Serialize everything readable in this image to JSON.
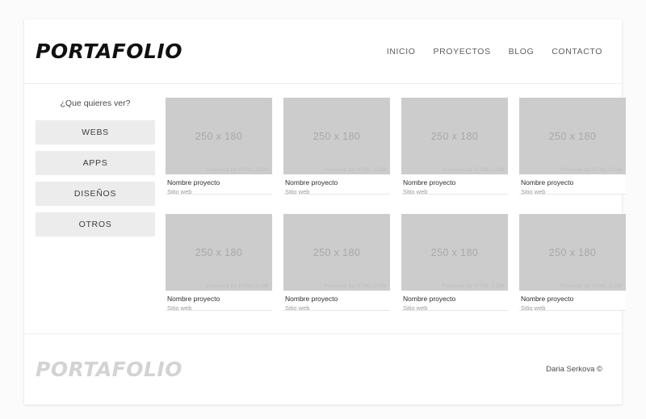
{
  "header": {
    "logo": "PORTAFOLIO",
    "nav": [
      {
        "label": "INICIO"
      },
      {
        "label": "PROYECTOS"
      },
      {
        "label": "BLOG"
      },
      {
        "label": "CONTACTO"
      }
    ]
  },
  "sidebar": {
    "title": "¿Que quieres ver?",
    "filters": [
      {
        "label": "WEBS"
      },
      {
        "label": "APPS"
      },
      {
        "label": "DISEÑOS"
      },
      {
        "label": "OTROS"
      }
    ]
  },
  "gallery": {
    "cards": [
      {
        "placeholder": "250 x 180",
        "watermark": "Powered by HTML.COM",
        "title": "Nombre proyecto",
        "subtitle": "Sitio web"
      },
      {
        "placeholder": "250 x 180",
        "watermark": "Powered by HTML.COM",
        "title": "Nombre proyecto",
        "subtitle": "Sitio web"
      },
      {
        "placeholder": "250 x 180",
        "watermark": "Powered by HTML.COM",
        "title": "Nombre proyecto",
        "subtitle": "Sitio web"
      },
      {
        "placeholder": "250 x 180",
        "watermark": "Powered by HTML.COM",
        "title": "Nombre proyecto",
        "subtitle": "Sitio web"
      },
      {
        "placeholder": "250 x 180",
        "watermark": "Powered by HTML.COM",
        "title": "Nombre proyecto",
        "subtitle": "Sitio web"
      },
      {
        "placeholder": "250 x 180",
        "watermark": "Powered by HTML.COM",
        "title": "Nombre proyecto",
        "subtitle": "Sitio web"
      },
      {
        "placeholder": "250 x 180",
        "watermark": "Powered by HTML.COM",
        "title": "Nombre proyecto",
        "subtitle": "Sitio web"
      },
      {
        "placeholder": "250 x 180",
        "watermark": "Powered by HTML.COM",
        "title": "Nombre proyecto",
        "subtitle": "Sitio web"
      }
    ]
  },
  "footer": {
    "logo": "PORTAFOLIO",
    "copyright": "Daria Serkova ©"
  },
  "colors": {
    "page_background": "#fbfbfb",
    "container_background": "#ffffff",
    "placeholder_gray": "#cccccc",
    "filter_button_gray": "#ececec",
    "divider": "#ededed",
    "footer_logo_gray": "#d3d3d3"
  }
}
